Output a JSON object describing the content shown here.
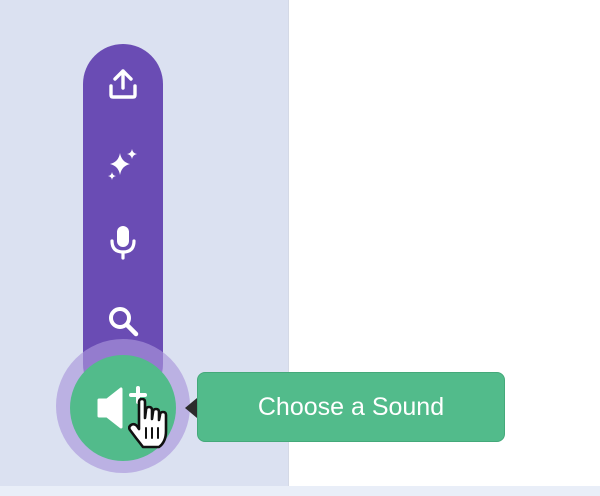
{
  "sound_menu": {
    "items": [
      {
        "icon": "upload-icon"
      },
      {
        "icon": "sparkle-icon"
      },
      {
        "icon": "microphone-icon"
      },
      {
        "icon": "search-icon"
      }
    ],
    "main_button": {
      "icon": "speaker-add-icon"
    },
    "tooltip": {
      "label": "Choose a Sound"
    }
  },
  "colors": {
    "menu_background": "#6a4cb4",
    "main_button": "#52bb8b",
    "halo": "#b5a6e0",
    "panel_background": "#dbe1f1"
  },
  "cursor": {
    "icon": "hand-pointer-icon"
  }
}
